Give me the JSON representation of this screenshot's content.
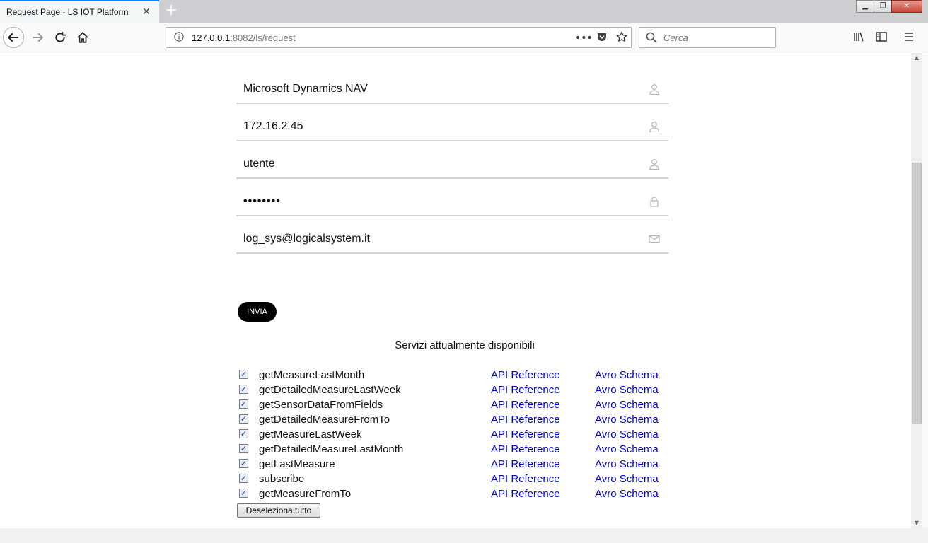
{
  "browser": {
    "tab_title": "Request Page - LS IOT Platform",
    "tab_close": "✕",
    "new_tab": "+",
    "url_host": "127.0.0.1",
    "url_rest": ":8082/ls/request",
    "url_more": "•••",
    "search_placeholder": "Cerca",
    "window_buttons": {
      "minimize": "▁",
      "restore": "❐",
      "close": "✕"
    }
  },
  "form": {
    "fields": [
      {
        "value": "Microsoft Dynamics NAV",
        "icon": "user-icon"
      },
      {
        "value": "172.16.2.45",
        "icon": "user-icon"
      },
      {
        "value": "utente",
        "icon": "user-icon"
      },
      {
        "value": "••••••••",
        "icon": "lock-icon"
      },
      {
        "value": "log_sys@logicalsystem.it",
        "icon": "envelope-icon"
      }
    ],
    "submit_label": "INVIA"
  },
  "services": {
    "title": "Servizi attualmente disponibili",
    "api_label": "API Reference",
    "avro_label": "Avro Schema",
    "check_mark": "✓",
    "items": [
      {
        "name": "getMeasureLastMonth",
        "checked": true
      },
      {
        "name": "getDetailedMeasureLastWeek",
        "checked": true
      },
      {
        "name": "getSensorDataFromFields",
        "checked": true
      },
      {
        "name": "getDetailedMeasureFromTo",
        "checked": true
      },
      {
        "name": "getMeasureLastWeek",
        "checked": true
      },
      {
        "name": "getDetailedMeasureLastMonth",
        "checked": true
      },
      {
        "name": "getLastMeasure",
        "checked": true
      },
      {
        "name": "subscribe",
        "checked": true
      },
      {
        "name": "getMeasureFromTo",
        "checked": true
      }
    ],
    "deselect_label": "Deseleziona tutto"
  },
  "colors": {
    "link": "#0000cc",
    "accent_tab": "#0a84ff",
    "button_bg": "#000000"
  }
}
